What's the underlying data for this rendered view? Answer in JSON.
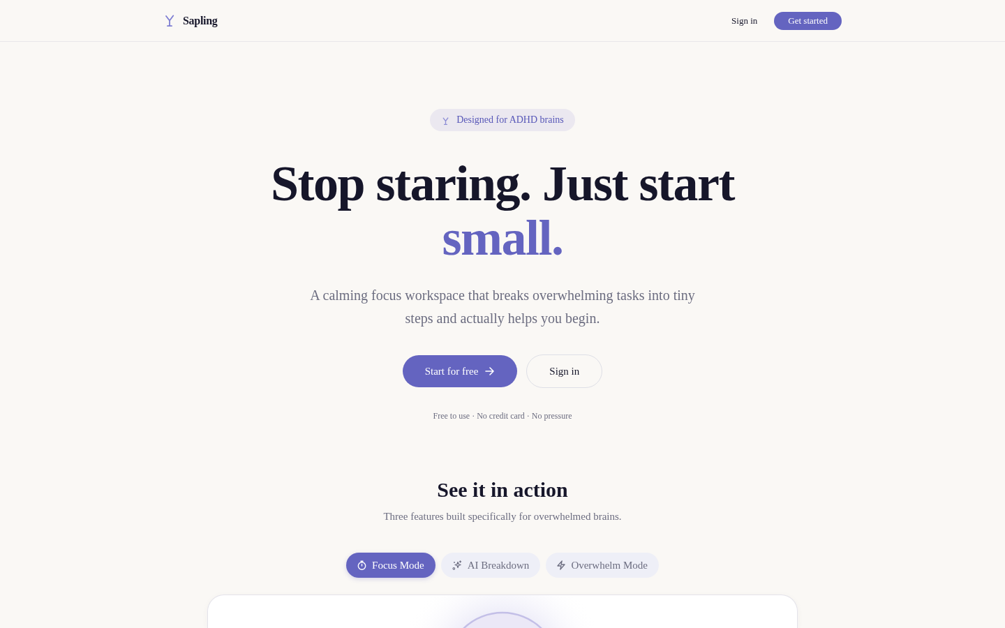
{
  "header": {
    "brand": "Sapling",
    "sign_in": "Sign in",
    "get_started": "Get started"
  },
  "hero": {
    "badge": "Designed for ADHD brains",
    "headline": "Stop staring. Just start",
    "headline_accent": "small.",
    "description": "A calming focus workspace that breaks overwhelming tasks into tiny steps and actually helps you begin.",
    "primary_button": "Start for free",
    "secondary_button": "Sign in",
    "note": "Free to use · No credit card · No pressure"
  },
  "demo": {
    "title": "See it in action",
    "subtitle": "Three features built specifically for overwhelmed brains.",
    "tabs": [
      {
        "label": "Focus Mode",
        "selected": true
      },
      {
        "label": "AI Breakdown",
        "selected": false
      },
      {
        "label": "Overwhelm Mode",
        "selected": false
      }
    ]
  }
}
